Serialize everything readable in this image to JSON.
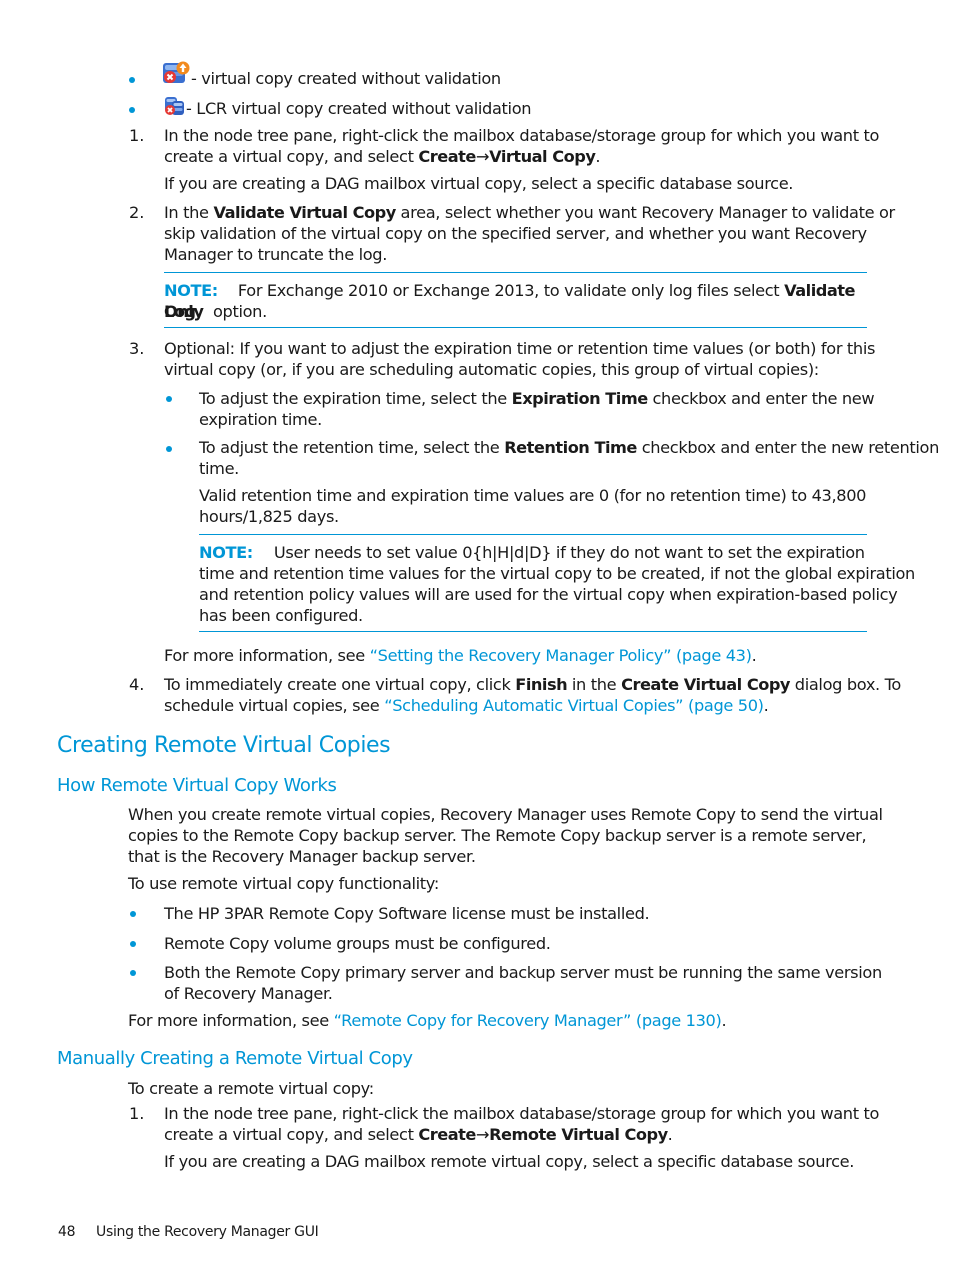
{
  "top_bullets": [
    {
      "icon": "virtual-copy-no-validation-icon",
      "text": " - virtual copy created without validation"
    },
    {
      "icon": "lcr-virtual-copy-no-validation-icon",
      "text": " - LCR virtual copy created without validation"
    }
  ],
  "steps_section1": {
    "step1": {
      "number": "1.",
      "text_a": "In the node tree pane, right-click the mailbox database/storage group for which you want to",
      "text_b": "create a virtual copy, and select ",
      "menu_a": "Create",
      "arrow": "→",
      "menu_b": "Virtual Copy",
      "period": ".",
      "sub": "If you are creating a DAG mailbox virtual copy, select a specific database source."
    },
    "step2": {
      "number": "2.",
      "l1_a": "In the ",
      "l1_bold": "Validate Virtual Copy",
      "l1_b": " area, select whether you want Recovery Manager to validate or",
      "l2": "skip validation of the virtual copy on the specified server, and whether you want Recovery",
      "l3": "Manager to truncate the log.",
      "note_label": "NOTE:",
      "note_l1": "For Exchange 2010 or Exchange 2013, to validate only log files select ",
      "note_bold1": "Validate Log",
      "note_bold2": "Only",
      "note_l2": "  option."
    },
    "step3": {
      "number": "3.",
      "l1": "Optional: If you want to adjust the expiration time or retention time values (or both) for this",
      "l2": "virtual copy (or, if you are scheduling automatic copies, this group of virtual copies):",
      "b1_a": "To adjust the expiration time, select the ",
      "b1_bold": "Expiration Time",
      "b1_b": " checkbox and enter the new",
      "b1_l2": "expiration time.",
      "b2_a": "To adjust the retention time, select the ",
      "b2_bold": "Retention Time",
      "b2_b": " checkbox and enter the new retention",
      "b2_l2": "time.",
      "valid_l1": "Valid retention time and expiration time values are 0 (for no retention time) to 43,800",
      "valid_l2": "hours/1,825 days.",
      "note_label": "NOTE:",
      "note_l1": "User needs to set value 0{h|H|d|D} if they do not want to set the expiration",
      "note_l2": "time and retention time values for the virtual copy to be created, if not the global expiration",
      "note_l3": "and retention policy values will are used for the virtual copy when expiration-based policy",
      "note_l4": "has been configured.",
      "more_a": "For more information, see ",
      "more_link": "“Setting the Recovery Manager Policy” (page 43)",
      "more_b": "."
    },
    "step4": {
      "number": "4.",
      "l1_a": "To immediately create one virtual copy, click ",
      "l1_bold1": "Finish",
      "l1_b": " in the ",
      "l1_bold2": "Create Virtual Copy",
      "l1_c": " dialog box. To",
      "l2_a": "schedule virtual copies, see ",
      "l2_link": "“Scheduling Automatic Virtual Copies” (page 50)",
      "l2_b": "."
    }
  },
  "section_remote": {
    "heading": "Creating Remote Virtual Copies",
    "sub1": {
      "heading": "How Remote Virtual Copy Works",
      "p_l1": "When you create remote virtual copies, Recovery Manager uses Remote Copy to send the virtual",
      "p_l2": "copies to the Remote Copy backup server. The Remote Copy backup server is a remote server,",
      "p_l3": "that is the Recovery Manager backup server.",
      "intro": "To use remote virtual copy functionality:",
      "bullets": [
        "The HP 3PAR Remote Copy Software license must be installed.",
        "Remote Copy volume groups must be configured.",
        "Both the Remote Copy primary server and backup server must be running the same version"
      ],
      "bullet3_l2": "of Recovery Manager.",
      "more_a": "For more information, see ",
      "more_link": "“Remote Copy for Recovery Manager” (page 130)",
      "more_b": "."
    },
    "sub2": {
      "heading": "Manually Creating a Remote Virtual Copy",
      "intro": "To create a remote virtual copy:",
      "step1": {
        "number": "1.",
        "l1": "In the node tree pane, right-click the mailbox database/storage group for which you want to",
        "l2_a": "create a virtual copy, and select ",
        "menu_a": "Create",
        "arrow": "→",
        "menu_b": "Remote Virtual Copy",
        "period": ".",
        "sub": "If you are creating a DAG mailbox remote virtual copy, select a specific database source."
      }
    }
  },
  "footer": {
    "page_number": "48",
    "chapter": "Using the Recovery Manager GUI"
  },
  "colors": {
    "accent": "#0096d6",
    "text": "#1a1a1a"
  }
}
